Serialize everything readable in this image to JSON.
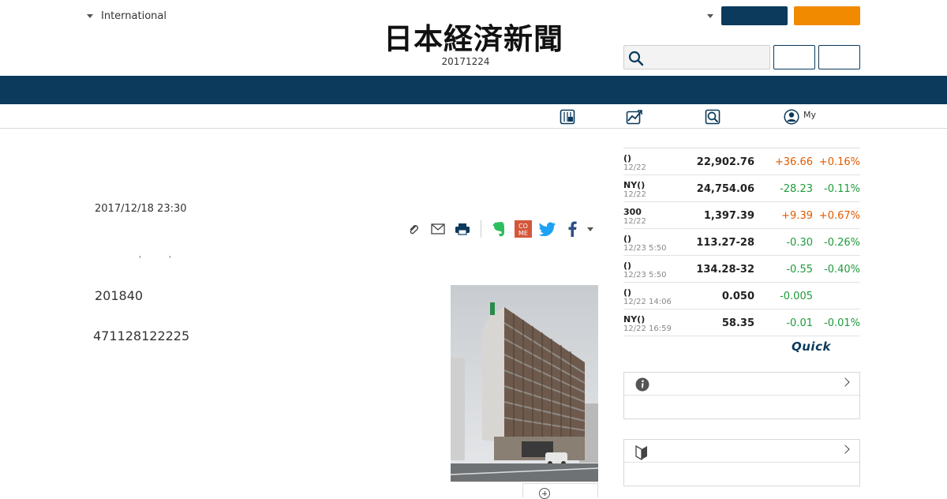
{
  "header": {
    "edition_label": "International",
    "logo_text": "日本経済新聞",
    "issue_date": "20171224"
  },
  "subnav": {
    "my_label": "My"
  },
  "article": {
    "timestamp": "2017/12/18 23:30",
    "small_marks": "' '",
    "paragraph1": "201840",
    "paragraph2": "471128122225"
  },
  "market": {
    "rows": [
      {
        "name": "()",
        "date": "12/22",
        "value": "22,902.76",
        "change": "+36.66",
        "pct": "+0.16%",
        "dir": "up"
      },
      {
        "name": "NY()",
        "date": "12/22",
        "value": "24,754.06",
        "change": "-28.23",
        "pct": "-0.11%",
        "dir": "down"
      },
      {
        "name": "300",
        "date": "12/22",
        "value": "1,397.39",
        "change": "+9.39",
        "pct": "+0.67%",
        "dir": "up"
      },
      {
        "name": "()",
        "date": "12/23 5:50",
        "value": "113.27-28",
        "change": "-0.30",
        "pct": "-0.26%",
        "dir": "down"
      },
      {
        "name": "()",
        "date": "12/23 5:50",
        "value": "134.28-32",
        "change": "-0.55",
        "pct": "-0.40%",
        "dir": "down"
      },
      {
        "name": "()",
        "date": "12/22 14:06",
        "value": "0.050",
        "change": "-0.005",
        "pct": "",
        "dir": "down"
      },
      {
        "name": "NY()",
        "date": "12/22 16:59",
        "value": "58.35",
        "change": "-0.01",
        "pct": "-0.01%",
        "dir": "down"
      }
    ],
    "provider_label": "Quick"
  },
  "colors": {
    "navy": "#0b3a5c",
    "orange": "#f28a00",
    "up": "#e05a00",
    "down": "#1e9b3a"
  },
  "icons": [
    "chevron-down-icon",
    "search-icon",
    "paper-icon",
    "chart-icon",
    "magnifier-book-icon",
    "user-icon",
    "clip-icon",
    "mail-icon",
    "print-icon",
    "evernote-icon",
    "come-icon",
    "twitter-icon",
    "facebook-icon",
    "info-icon",
    "beginner-mark-icon",
    "chevron-right-icon",
    "zoom-in-icon"
  ]
}
